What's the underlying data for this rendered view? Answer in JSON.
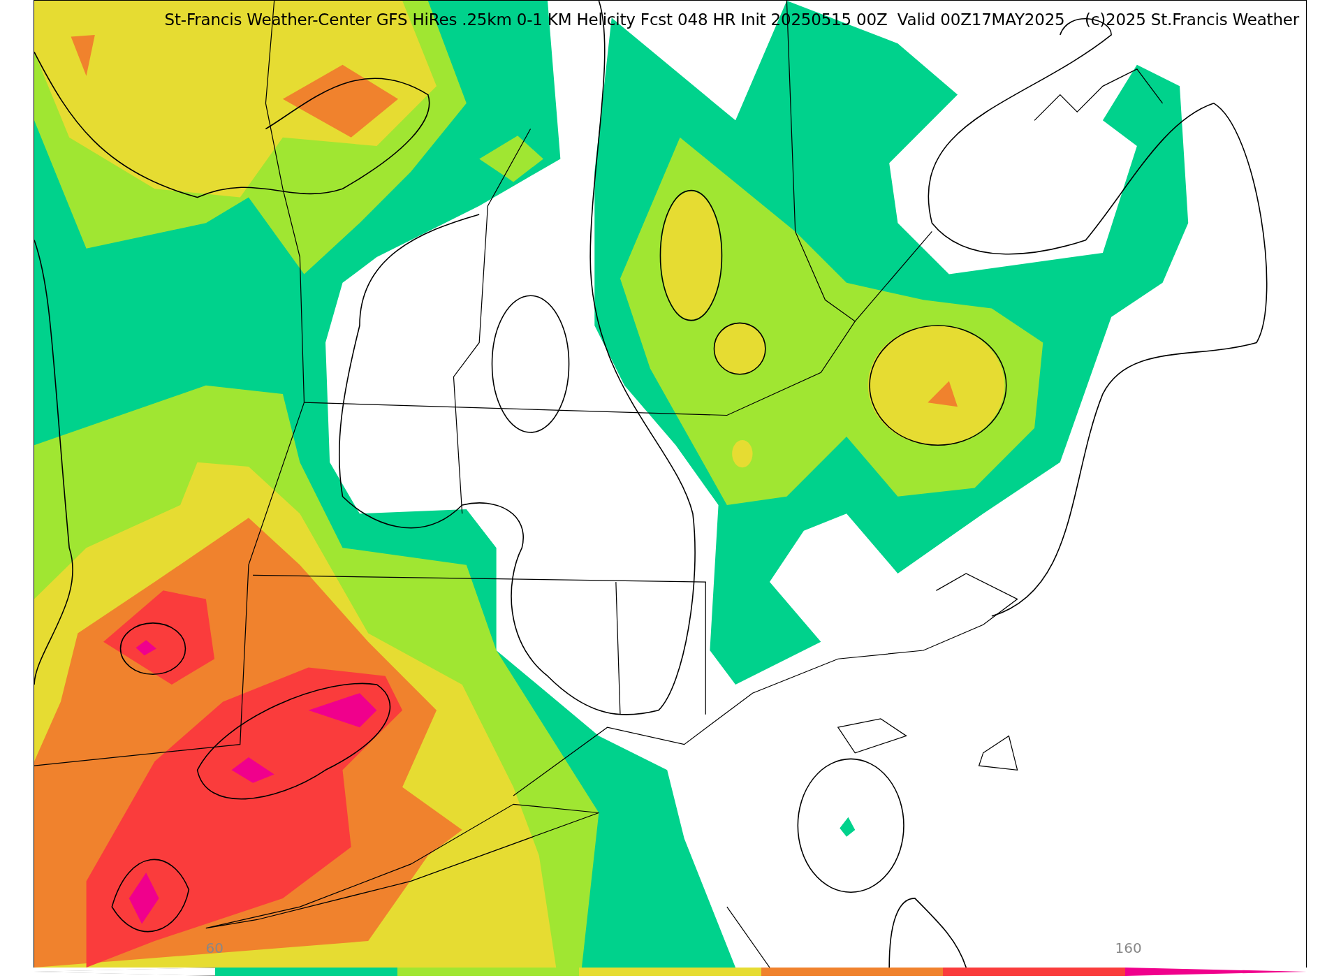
{
  "title": "St-Francis Weather-Center GFS HiRes .25km 0-1 KM Helicity Fcst 048 HR Init 20250515 00Z  Valid 00Z17MAY2025    (c)2025 St.Francis Weather",
  "colorbar": {
    "segments": [
      {
        "kind": "extend",
        "color": "#ffffff"
      },
      {
        "kind": "bin",
        "color": "#00d28c",
        "label": "60"
      },
      {
        "kind": "bin",
        "color": "#a0e632"
      },
      {
        "kind": "bin",
        "color": "#e6dc32"
      },
      {
        "kind": "bin",
        "color": "#f0822d"
      },
      {
        "kind": "bin",
        "color": "#fa3c3c"
      },
      {
        "kind": "extend",
        "color": "#f0008c",
        "label": "160"
      }
    ]
  }
}
